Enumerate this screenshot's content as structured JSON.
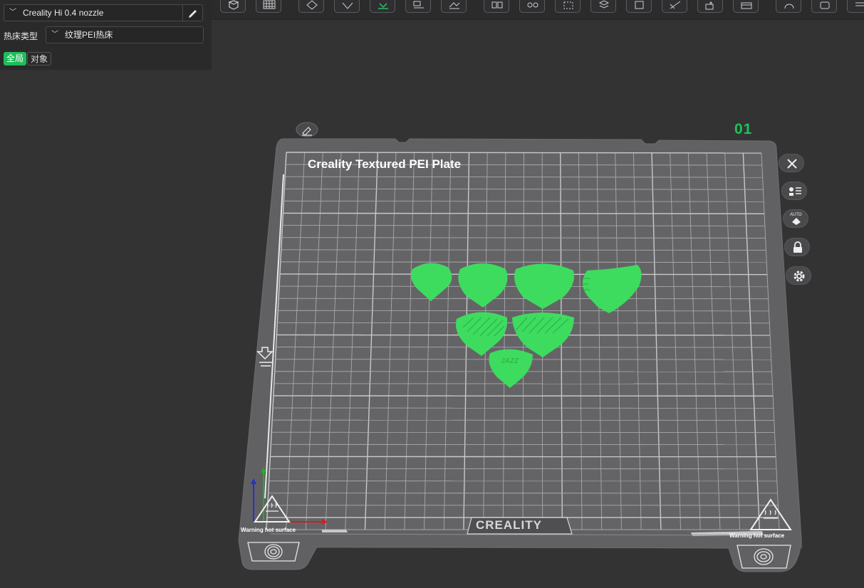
{
  "printer": {
    "value": "Creality Hi 0.4 nozzle"
  },
  "bed_type": {
    "label": "热床类型",
    "value": "纹理PEI热床"
  },
  "tabs": [
    {
      "label": "全局",
      "active": true
    },
    {
      "label": "对象",
      "active": false
    }
  ],
  "plate": {
    "number": "01",
    "title": "Creality Textured PEI Plate",
    "brand": "CREALITY",
    "warning_left": "Warning hot surface",
    "warning_right": "Warning hot surface",
    "emboss_text": "JAZZ"
  },
  "side_buttons": [
    {
      "icon": "close-icon"
    },
    {
      "icon": "arrange-icon"
    },
    {
      "icon": "auto-orient-icon",
      "label": "AUTO"
    },
    {
      "icon": "lock-icon"
    },
    {
      "icon": "gear-icon"
    }
  ],
  "toolbar_icons": [
    "cube-icon",
    "grid-icon",
    "add-shape-icon",
    "shape-icon",
    "import-icon",
    "arrange-icon",
    "split-icon",
    "layout-icon",
    "settings-icon",
    "measure-icon",
    "cut-icon",
    "support-icon",
    "seam-icon",
    "emboss-icon",
    "align-icon",
    "text-icon",
    "assembly-icon",
    "view-icon",
    "more-icon"
  ],
  "colors": {
    "accent": "#1fbd5a",
    "model": "#3ddc5e",
    "plate": "#5f5f62",
    "background": "#333334"
  }
}
